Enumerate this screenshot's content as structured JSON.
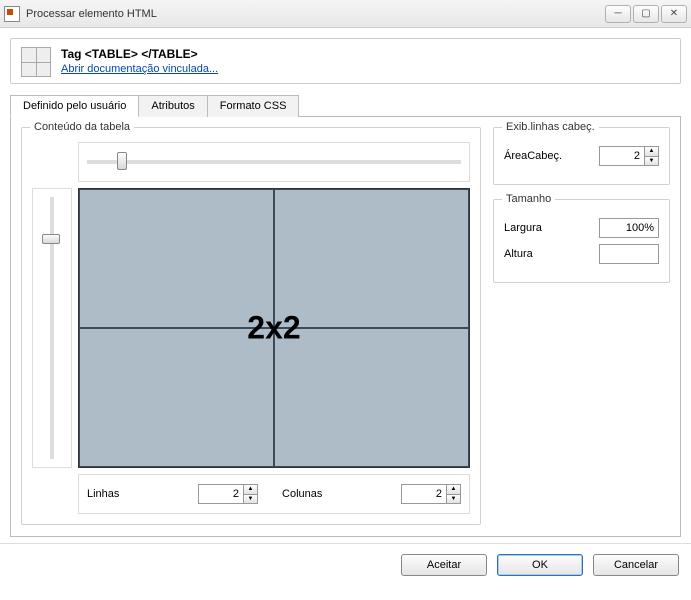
{
  "window": {
    "title": "Processar elemento HTML"
  },
  "header": {
    "tag_name": "Tag <TABLE> </TABLE>",
    "doc_link": "Abrir documentação vinculada..."
  },
  "tabs": {
    "user_defined": "Definido pelo usuário",
    "attributes": "Atributos",
    "css_format": "Formato CSS"
  },
  "table_content": {
    "group_title": "Conteúdo da tabela",
    "preview_label": "2x2",
    "rows_label": "Linhas",
    "rows_value": "2",
    "cols_label": "Colunas",
    "cols_value": "2"
  },
  "header_rows": {
    "group_title": "Exib.linhas cabeç.",
    "area_label": "ÁreaCabeç.",
    "area_value": "2"
  },
  "size": {
    "group_title": "Tamanho",
    "width_label": "Largura",
    "width_value": "100%",
    "height_label": "Altura",
    "height_value": ""
  },
  "buttons": {
    "accept": "Aceitar",
    "ok": "OK",
    "cancel": "Cancelar"
  }
}
